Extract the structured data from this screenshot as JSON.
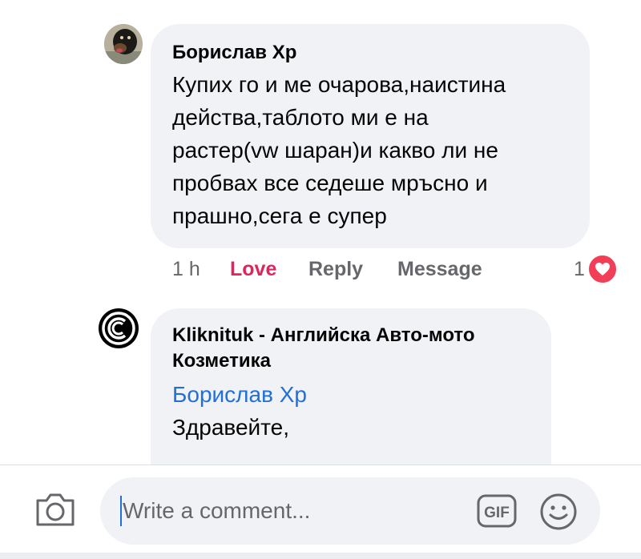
{
  "comments": [
    {
      "author": "Борислав Хр",
      "lines": [
        "Купих го и ме очарова,наистина",
        "действа,таблото ми е на",
        "растер(vw шаран)и какво ли не",
        "пробвах все седеше мръсно и",
        "прашно,сега е супер"
      ],
      "time": "1 h",
      "actions": [
        "Love",
        "Reply",
        "Message"
      ],
      "reaction_count": "1",
      "reaction_icon": "heart-icon"
    },
    {
      "author_lines": [
        "Kliknituk - Английска Авто-мото",
        "Козметика"
      ],
      "mention": "Борислав Хр",
      "lines": [
        "Здравейте,"
      ],
      "avatar_icon": "kliknituk-logo-icon"
    }
  ],
  "composer": {
    "placeholder": "Write a comment...",
    "gif_label": "GIF",
    "camera_icon": "camera-icon",
    "emoji_icon": "smiley-icon"
  },
  "colors": {
    "bubble": "#f0f2f5",
    "love": "#e0245e",
    "mention": "#216fdb",
    "meta": "#65676b",
    "heart": "#f33e58"
  }
}
